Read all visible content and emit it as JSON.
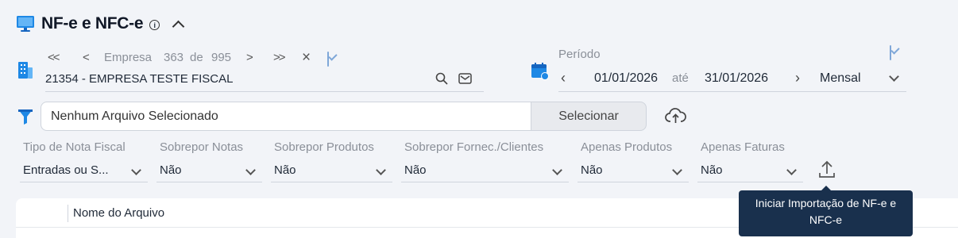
{
  "header": {
    "title": "NF-e e NFC-e",
    "info_icon": "info-icon",
    "collapse_icon": "chevron-up-icon"
  },
  "company": {
    "nav_first": "<<",
    "nav_prev": "<",
    "label": "Empresa",
    "current": "363",
    "of": "de",
    "total": "995",
    "nav_next": ">",
    "nav_last": ">>",
    "clear": "×",
    "selected": "21354 - EMPRESA TESTE FISCAL"
  },
  "period": {
    "label": "Período",
    "start": "01/01/2026",
    "until": "até",
    "end": "31/01/2026",
    "frequency": "Mensal"
  },
  "file": {
    "placeholder": "Nenhum Arquivo Selecionado",
    "select_label": "Selecionar"
  },
  "filters": [
    {
      "label": "Tipo de Nota Fiscal",
      "value": "Entradas ou S..."
    },
    {
      "label": "Sobrepor Notas",
      "value": "Não"
    },
    {
      "label": "Sobrepor Produtos",
      "value": "Não"
    },
    {
      "label": "Sobrepor Fornec./Clientes",
      "value": "Não"
    },
    {
      "label": "Apenas Produtos",
      "value": "Não"
    },
    {
      "label": "Apenas Faturas",
      "value": "Não"
    }
  ],
  "table": {
    "column_name": "Nome do Arquivo"
  },
  "tooltip": {
    "line1": "Iniciar Importação de NF-e e",
    "line2": "NFC-e"
  },
  "colors": {
    "accent": "#1f6fcf",
    "tooltip_bg": "#19304d"
  }
}
